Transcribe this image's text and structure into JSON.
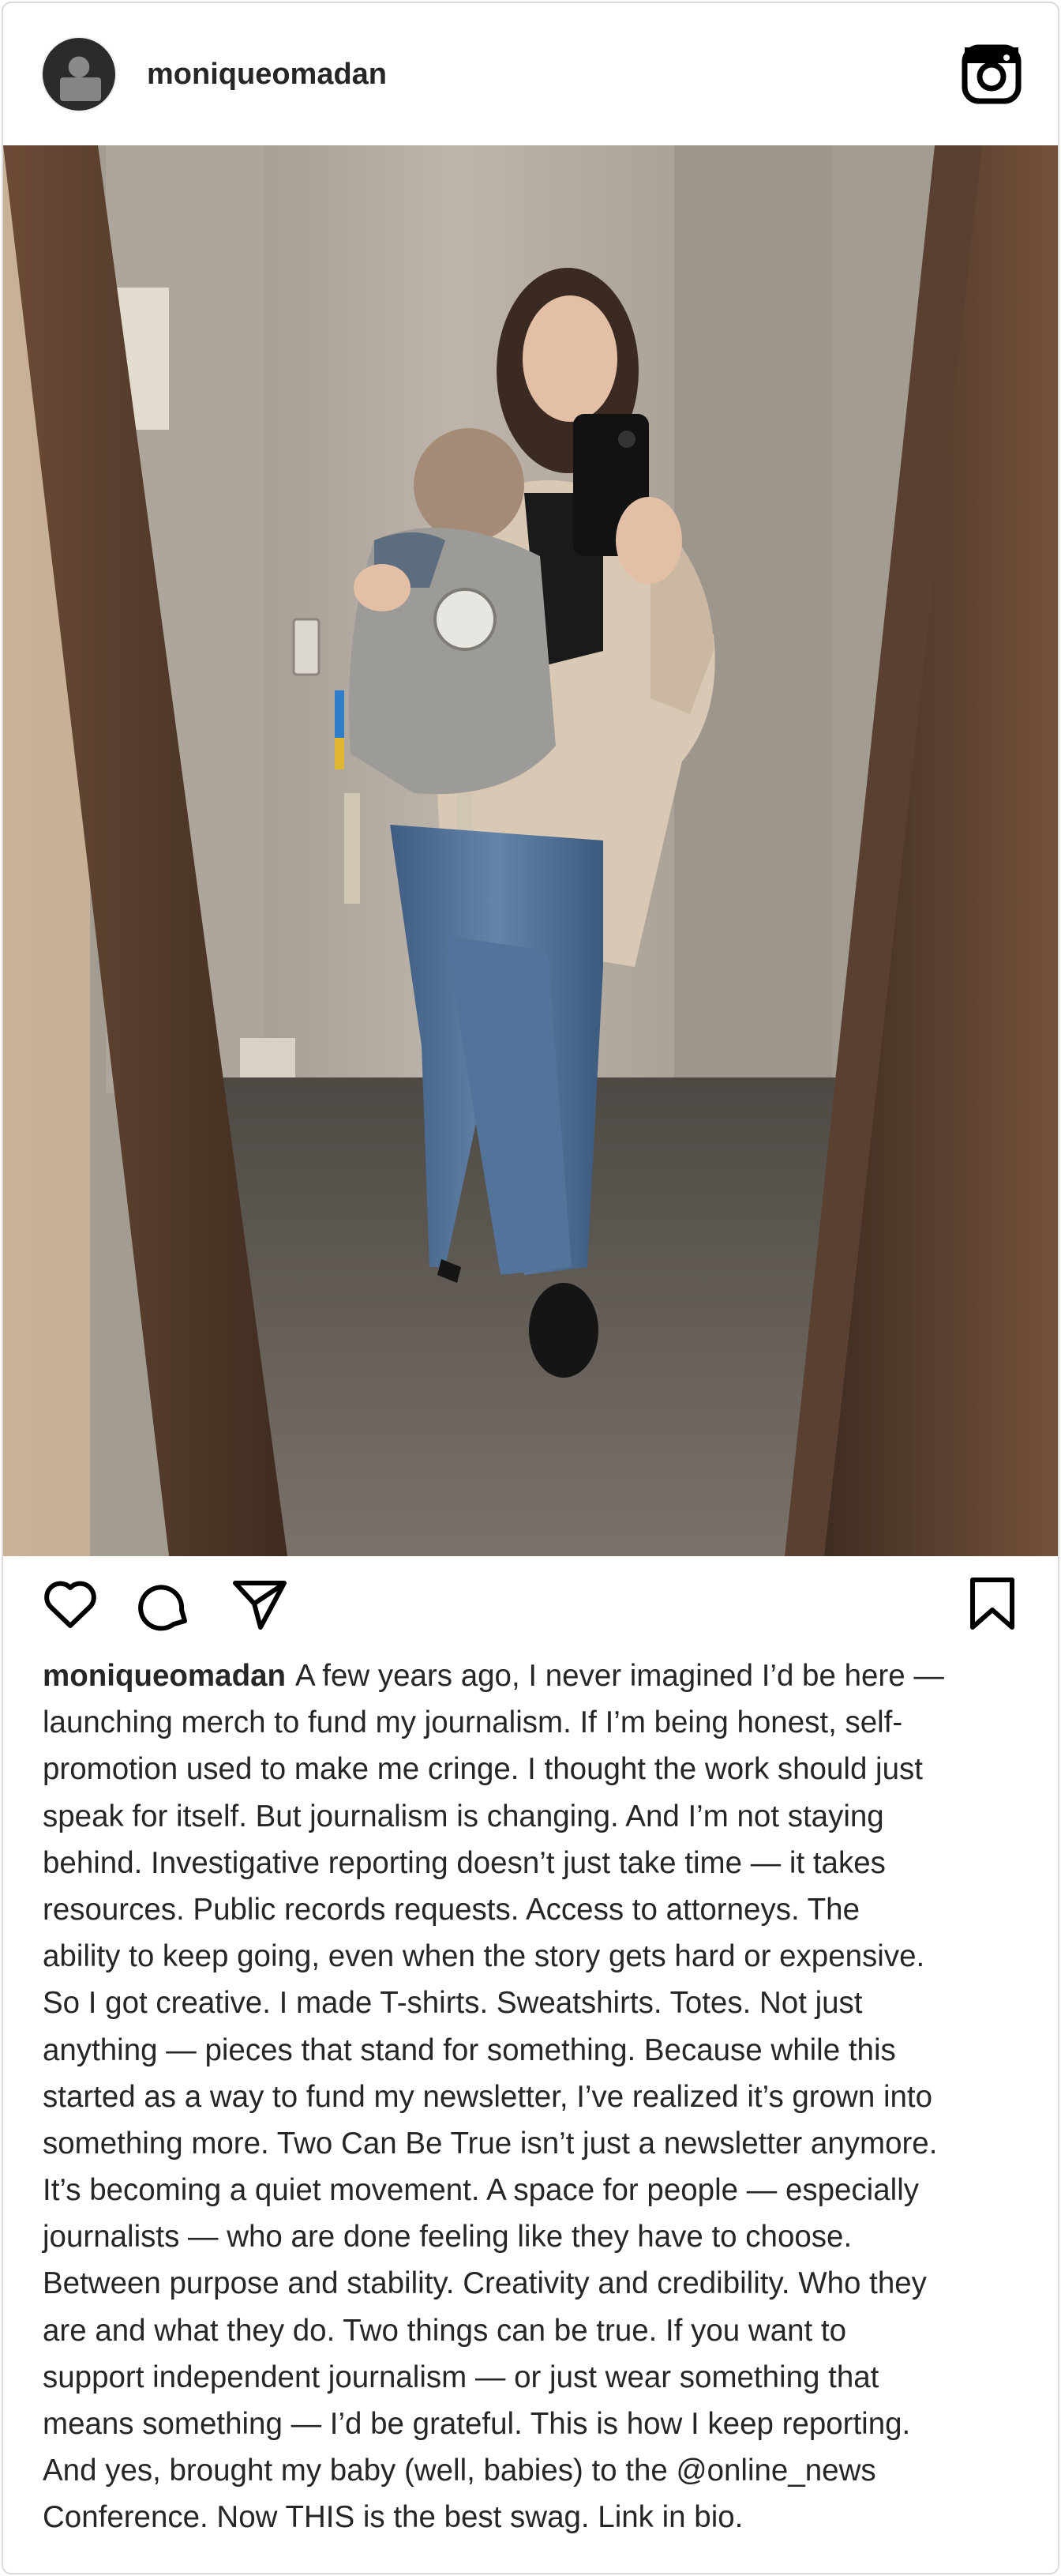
{
  "post": {
    "username": "moniqueomadan",
    "caption_lines": [
      "A few years ago, I never imagined I’d be here —",
      "launching merch to fund my journalism. If I’m being honest, self-",
      "promotion used to make me cringe. I thought the work should just",
      "speak for itself. But journalism is changing. And I’m not staying",
      "behind. Investigative reporting doesn’t just take time — it takes",
      "resources. Public records requests. Access to attorneys. The",
      "ability to keep going, even when the story gets hard or expensive.",
      "So I got creative. I made T-shirts. Sweatshirts. Totes. Not just",
      "anything — pieces that stand for something. Because while this",
      "started as a way to fund my newsletter, I’ve realized it’s grown into",
      "something more. Two Can Be True isn’t just a newsletter anymore.",
      "It’s becoming a quiet movement. A space for people — especially",
      "journalists — who are done feeling like they have to choose.",
      "Between purpose and stability. Creativity and credibility. Who they",
      "are and what they do. Two things can be true. If you want to",
      "support independent journalism — or just wear something that",
      "means something — I’d be grateful. This is how I keep reporting.",
      "And yes, brought my baby (well, babies) to the @online_news",
      "Conference. Now THIS is the best swag. Link in bio."
    ]
  },
  "icons": {
    "avatar": "profile-avatar",
    "brand": "instagram-icon",
    "like": "heart-icon",
    "comment": "comment-bubble-icon",
    "share": "paper-plane-icon",
    "save": "bookmark-icon"
  },
  "colors": {
    "text": "#262626",
    "border": "#dbdbdb"
  }
}
